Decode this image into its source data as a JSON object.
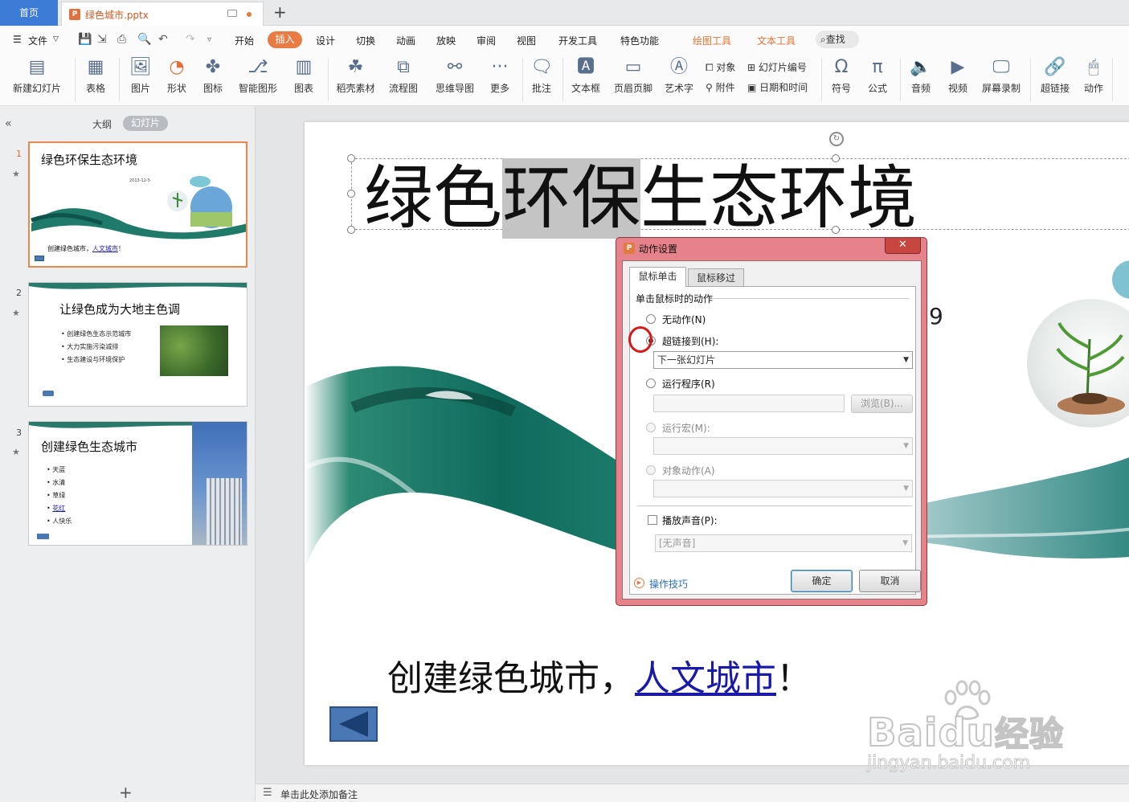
{
  "tabs": {
    "home": "首页",
    "doc": "绿色城市.pptx"
  },
  "menu": {
    "file": "文件",
    "items": [
      "开始",
      "插入",
      "设计",
      "切换",
      "动画",
      "放映",
      "审阅",
      "视图",
      "开发工具",
      "特色功能"
    ],
    "tools": [
      "绘图工具",
      "文本工具"
    ],
    "search": "查找"
  },
  "ribbon": {
    "new_slide": "新建幻灯片",
    "table": "表格",
    "picture": "图片",
    "shape": "形状",
    "icon": "图标",
    "smartart": "智能图形",
    "chart": "图表",
    "material": "稻壳素材",
    "flowchart": "流程图",
    "mindmap": "思维导图",
    "more": "更多",
    "comment": "批注",
    "textbox": "文本框",
    "header_footer": "页眉页脚",
    "wordart": "艺术字",
    "object": "对象",
    "slide_number": "幻灯片编号",
    "attachment": "附件",
    "datetime": "日期和时间",
    "symbol": "符号",
    "formula": "公式",
    "audio": "音频",
    "video": "视频",
    "screen_record": "屏幕录制",
    "hyperlink": "超链接",
    "action": "动作"
  },
  "left_panel": {
    "outline_tab": "大纲",
    "slides_tab": "幻灯片",
    "slides": [
      {
        "num": "1",
        "title": "绿色环保生态环境",
        "date": "2013-12-5",
        "footer": "创建绿色城市，",
        "footer_link": "人文城市",
        "footer_end": "！"
      },
      {
        "num": "2",
        "title": "让绿色成为大地主色调",
        "bullets": [
          "创建绿色生态示范城市",
          "大力实施污染减排",
          "生态建设与环境保护"
        ]
      },
      {
        "num": "3",
        "title": "创建绿色生态城市",
        "bullets": [
          "天蓝",
          "水清",
          "草绿",
          "花红",
          "人快乐"
        ]
      }
    ]
  },
  "slide": {
    "title_pre": "绿色",
    "title_highlight": "环保",
    "title_post": "生态环境",
    "footer_text": "创建绿色城市，",
    "footer_link": "人文城市",
    "footer_end": "！"
  },
  "dialog": {
    "title": "动作设置",
    "tab_click": "鼠标单击",
    "tab_hover": "鼠标移过",
    "group_label": "单击鼠标时的动作",
    "none": "无动作(N)",
    "hyperlink": "超链接到(H):",
    "hyperlink_value": "下一张幻灯片",
    "run_program": "运行程序(R)",
    "browse": "浏览(B)...",
    "run_macro": "运行宏(M):",
    "object_action": "对象动作(A)",
    "play_sound": "播放声音(P):",
    "sound_value": "[无声音]",
    "tips": "操作技巧",
    "ok": "确定",
    "cancel": "取消"
  },
  "notes": {
    "placeholder": "单击此处添加备注"
  },
  "watermark": {
    "brand": "Bai",
    "brand2": "du",
    "brand3": "经验",
    "url": "jingyan.baidu.com"
  },
  "colors": {
    "accent": "#e87c45",
    "home_tab": "#3c7bd5",
    "link": "#1a1aa8",
    "dialog_frame": "#e6828a"
  }
}
